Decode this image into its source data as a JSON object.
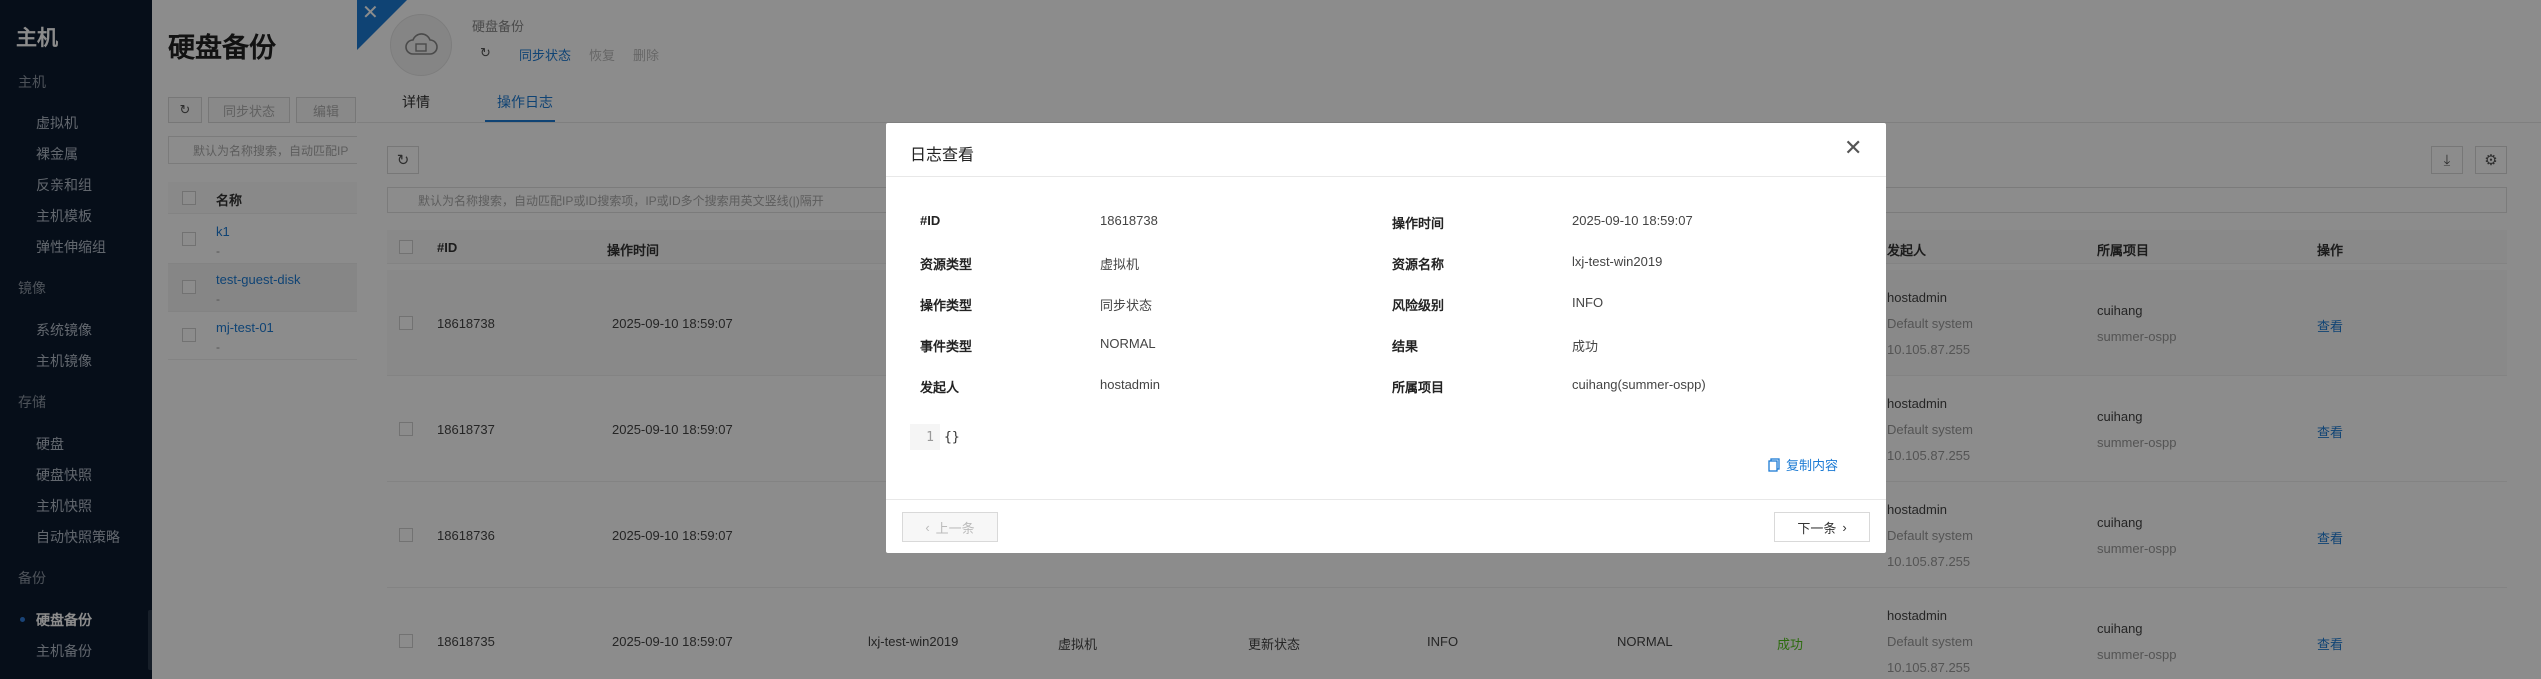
{
  "sidebar": {
    "app_title": "主机",
    "groups": [
      {
        "label": "主机",
        "items": [
          "虚拟机",
          "裸金属",
          "反亲和组",
          "主机模板",
          "弹性伸缩组"
        ]
      },
      {
        "label": "镜像",
        "items": [
          "系统镜像",
          "主机镜像"
        ]
      },
      {
        "label": "存储",
        "items": [
          "硬盘",
          "硬盘快照",
          "主机快照",
          "自动快照策略"
        ]
      },
      {
        "label": "备份",
        "items": [
          "硬盘备份",
          "主机备份"
        ]
      }
    ],
    "active_item": "硬盘备份"
  },
  "list_page": {
    "title": "硬盘备份",
    "toolbar": [
      "同步状态",
      "编辑"
    ],
    "search_placeholder": "默认为名称搜索，自动匹配IP",
    "column_name": "名称",
    "rows": [
      {
        "name": "k1",
        "sub": "-"
      },
      {
        "name": "test-guest-disk",
        "sub": "-"
      },
      {
        "name": "mj-test-01",
        "sub": "-"
      }
    ]
  },
  "drawer": {
    "resource_name": "硬盘备份",
    "actions": [
      "同步状态",
      "恢复",
      "删除"
    ],
    "tabs": [
      "详情",
      "操作日志"
    ],
    "active_tab": "操作日志",
    "search_placeholder": "默认为名称搜索，自动匹配IP或ID搜索项，IP或ID多个搜索用英文竖线(|)隔开",
    "columns": {
      "id": "#ID",
      "time": "操作时间",
      "initiator": "发起人",
      "project": "所属项目",
      "ops": "操作"
    },
    "rows": [
      {
        "id": "18618738",
        "time": "2025-09-10 18:59:07",
        "resource": "",
        "rtype": "",
        "op": "",
        "risk": "",
        "event": "",
        "result": "",
        "user": "hostadmin",
        "system": "Default system",
        "ip": "10.105.87.255",
        "project": "cuihang",
        "domain": "summer-ospp",
        "view": "查看"
      },
      {
        "id": "18618737",
        "time": "2025-09-10 18:59:07",
        "resource": "",
        "rtype": "",
        "op": "",
        "risk": "",
        "event": "",
        "result": "",
        "user": "hostadmin",
        "system": "Default system",
        "ip": "10.105.87.255",
        "project": "cuihang",
        "domain": "summer-ospp",
        "view": "查看"
      },
      {
        "id": "18618736",
        "time": "2025-09-10 18:59:07",
        "resource": "",
        "rtype": "",
        "op": "",
        "risk": "",
        "event": "",
        "result": "",
        "user": "hostadmin",
        "system": "Default system",
        "ip": "10.105.87.255",
        "project": "cuihang",
        "domain": "summer-ospp",
        "view": "查看"
      },
      {
        "id": "18618735",
        "time": "2025-09-10 18:59:07",
        "resource": "lxj-test-win2019",
        "rtype": "虚拟机",
        "op": "更新状态",
        "risk": "INFO",
        "event": "NORMAL",
        "result": "成功",
        "user": "hostadmin",
        "system": "Default system",
        "ip": "10.105.87.255",
        "project": "cuihang",
        "domain": "summer-ospp",
        "view": "查看"
      }
    ]
  },
  "modal": {
    "title": "日志查看",
    "fields": [
      {
        "k": "#ID",
        "v": "18618738"
      },
      {
        "k": "操作时间",
        "v": "2025-09-10 18:59:07"
      },
      {
        "k": "资源类型",
        "v": "虚拟机"
      },
      {
        "k": "资源名称",
        "v": "lxj-test-win2019"
      },
      {
        "k": "操作类型",
        "v": "同步状态"
      },
      {
        "k": "风险级别",
        "v": "INFO"
      },
      {
        "k": "事件类型",
        "v": "NORMAL"
      },
      {
        "k": "结果",
        "v": "成功"
      },
      {
        "k": "发起人",
        "v": "hostadmin"
      },
      {
        "k": "所属项目",
        "v": "cuihang(summer-ospp)"
      }
    ],
    "code_line_no": "1",
    "code_text": "{}",
    "copy_label": "复制内容",
    "prev_label": "上一条",
    "next_label": "下一条"
  },
  "colors": {
    "accent": "#1c7bd4",
    "success": "#52c41a",
    "sidebar": "#0c1b2f"
  }
}
